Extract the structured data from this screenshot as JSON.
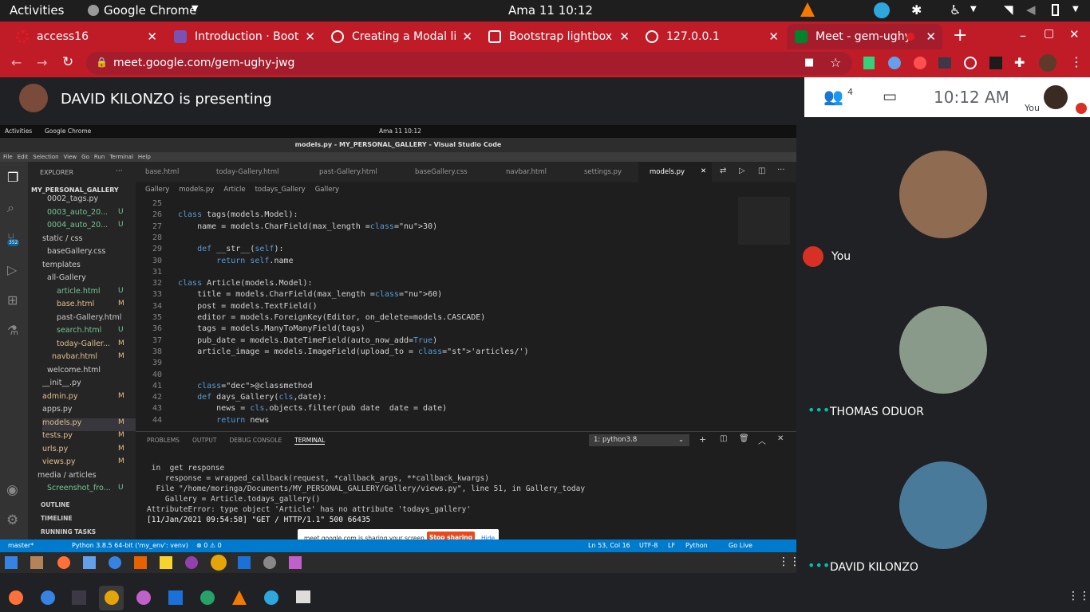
{
  "topbar": {
    "activities": "Activities",
    "app": "Google Chrome",
    "clock": "Ama 11  10:12"
  },
  "chrome_tabs": [
    {
      "title": "access16",
      "color": "#e01b24"
    },
    {
      "title": "Introduction · Boot",
      "color": "#7952b3"
    },
    {
      "title": "Creating a Modal li",
      "color": "#ffffff"
    },
    {
      "title": "Bootstrap lightbox",
      "color": "#ffffff"
    },
    {
      "title": "127.0.0.1",
      "color": "#ffffff"
    },
    {
      "title": "Meet - gem-ughy",
      "color": "#00832d"
    }
  ],
  "omnibar": {
    "url": "meet.google.com/gem-ughy-jwg"
  },
  "meet": {
    "presenter": "DAVID KILONZO is presenting",
    "participants_count": "4",
    "time": "10:12  AM",
    "you_label": "You",
    "participants": [
      {
        "name": "You"
      },
      {
        "name": "THOMAS ODUOR"
      },
      {
        "name": "DAVID KILONZO"
      }
    ]
  },
  "shared": {
    "topbar": {
      "activities": "Activities",
      "app": "Google Chrome",
      "clock": "Ama 11  10:12"
    },
    "window_title": "models.py - MY_PERSONAL_GALLERY - Visual Studio Code",
    "menu": [
      "File",
      "Edit",
      "Selection",
      "View",
      "Go",
      "Run",
      "Terminal",
      "Help"
    ],
    "activity_badge": "352",
    "explorer": {
      "title": "EXPLORER",
      "root": "MY_PERSONAL_GALLERY",
      "items": [
        {
          "label": "0002_tags.py",
          "badge": ""
        },
        {
          "label": "0003_auto_20...",
          "badge": "U"
        },
        {
          "label": "0004_auto_20...",
          "badge": "U"
        },
        {
          "label": "static / css",
          "badge": ""
        },
        {
          "label": "baseGallery.css",
          "badge": ""
        },
        {
          "label": "templates",
          "badge": ""
        },
        {
          "label": "all-Gallery",
          "badge": ""
        },
        {
          "label": "article.html",
          "badge": "U"
        },
        {
          "label": "base.html",
          "badge": "M"
        },
        {
          "label": "past-Gallery.html",
          "badge": ""
        },
        {
          "label": "search.html",
          "badge": "U"
        },
        {
          "label": "today-Galler...",
          "badge": "M"
        },
        {
          "label": "navbar.html",
          "badge": "M"
        },
        {
          "label": "welcome.html",
          "badge": ""
        },
        {
          "label": "__init__.py",
          "badge": ""
        },
        {
          "label": "admin.py",
          "badge": "M"
        },
        {
          "label": "apps.py",
          "badge": ""
        },
        {
          "label": "models.py",
          "badge": "M"
        },
        {
          "label": "tests.py",
          "badge": "M"
        },
        {
          "label": "urls.py",
          "badge": "M"
        },
        {
          "label": "views.py",
          "badge": "M"
        },
        {
          "label": "media / articles",
          "badge": ""
        },
        {
          "label": "Screenshot_fro...",
          "badge": "U"
        }
      ],
      "sections": [
        "OUTLINE",
        "TIMELINE",
        "RUNNING TASKS"
      ]
    },
    "editor_tabs": [
      "base.html",
      "today-Gallery.html",
      "past-Gallery.html",
      "baseGallery.css",
      "navbar.html",
      "settings.py",
      "models.py"
    ],
    "breadcrumb": [
      "Gallery",
      "models.py",
      "Article",
      "todays_Gallery",
      "Gallery"
    ],
    "code_lines": [
      {
        "n": "25",
        "t": ""
      },
      {
        "n": "26",
        "t": "class tags(models.Model):"
      },
      {
        "n": "27",
        "t": "    name = models.CharField(max_length =30)"
      },
      {
        "n": "28",
        "t": ""
      },
      {
        "n": "29",
        "t": "    def __str__(self):"
      },
      {
        "n": "30",
        "t": "        return self.name"
      },
      {
        "n": "31",
        "t": ""
      },
      {
        "n": "32",
        "t": "class Article(models.Model):"
      },
      {
        "n": "33",
        "t": "    title = models.CharField(max_length =60)"
      },
      {
        "n": "34",
        "t": "    post = models.TextField()"
      },
      {
        "n": "35",
        "t": "    editor = models.ForeignKey(Editor, on_delete=models.CASCADE)"
      },
      {
        "n": "36",
        "t": "    tags = models.ManyToManyField(tags)"
      },
      {
        "n": "37",
        "t": "    pub_date = models.DateTimeField(auto_now_add=True)"
      },
      {
        "n": "38",
        "t": "    article_image = models.ImageField(upload_to = 'articles/')"
      },
      {
        "n": "39",
        "t": ""
      },
      {
        "n": "40",
        "t": ""
      },
      {
        "n": "41",
        "t": "    @classmethod"
      },
      {
        "n": "42",
        "t": "    def days_Gallery(cls,date):"
      },
      {
        "n": "43",
        "t": "        news = cls.objects.filter(pub date  date = date)"
      },
      {
        "n": "44",
        "t": "        return news"
      }
    ],
    "panel_tabs": [
      "PROBLEMS",
      "OUTPUT",
      "DEBUG CONSOLE",
      "TERMINAL"
    ],
    "terminal_select": "1: python3.8",
    "terminal_lines": [
      " in  get response",
      "    response = wrapped_callback(request, *callback_args, **callback_kwargs)",
      "  File \"/home/moringa/Documents/MY_PERSONAL_GALLERY/Gallery/views.py\", line 51, in Gallery_today",
      "    Gallery = Article.todays_gallery()",
      "AttributeError: type object 'Article' has no attribute 'todays_gallery'",
      "[11/Jan/2021 09:54:58] \"GET / HTTP/1.1\" 500 66435"
    ],
    "share_bar": {
      "text": "meet.google.com is sharing your screen.",
      "stop": "Stop sharing",
      "hide": "Hide"
    },
    "status": {
      "branch": "master*",
      "python": "Python 3.8.5 64-bit ('my_env': venv)",
      "problems": "⊗ 0 ⚠ 0",
      "pos": "Ln 53, Col 16",
      "enc": "UTF-8",
      "eol": "LF",
      "lang": "Python",
      "live": "Go Live"
    }
  }
}
